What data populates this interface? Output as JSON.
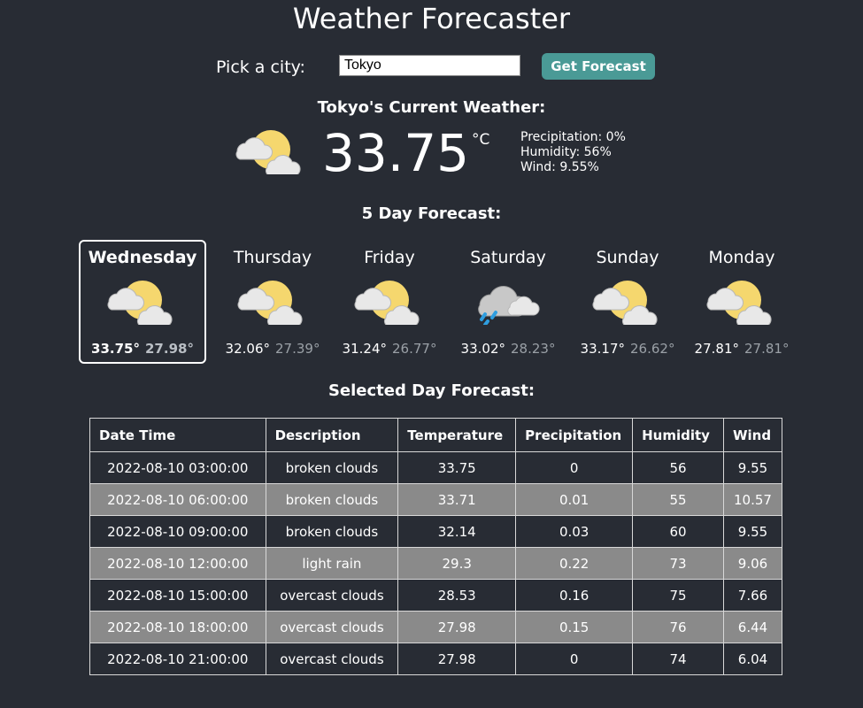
{
  "app": {
    "title": "Weather Forecaster"
  },
  "picker": {
    "label": "Pick a city:",
    "city_value": "Tokyo",
    "button_label": "Get Forecast"
  },
  "current": {
    "heading": "Tokyo's Current Weather:",
    "icon": "partly-cloudy-icon",
    "temperature": "33.75",
    "unit": "°C",
    "precipitation": "Precipitation: 0%",
    "humidity": "Humidity: 56%",
    "wind": "Wind: 9.55%"
  },
  "forecast": {
    "heading": "5 Day Forecast:",
    "days": [
      {
        "name": "Wednesday",
        "icon": "partly-cloudy-icon",
        "high": "33.75°",
        "low": "27.98°",
        "selected": true
      },
      {
        "name": "Thursday",
        "icon": "partly-cloudy-icon",
        "high": "32.06°",
        "low": "27.39°",
        "selected": false
      },
      {
        "name": "Friday",
        "icon": "partly-cloudy-icon",
        "high": "31.24°",
        "low": "26.77°",
        "selected": false
      },
      {
        "name": "Saturday",
        "icon": "rain-cloud-icon",
        "high": "33.02°",
        "low": "28.23°",
        "selected": false
      },
      {
        "name": "Sunday",
        "icon": "partly-cloudy-icon",
        "high": "33.17°",
        "low": "26.62°",
        "selected": false
      },
      {
        "name": "Monday",
        "icon": "partly-cloudy-icon",
        "high": "27.81°",
        "low": "27.81°",
        "selected": false
      }
    ]
  },
  "selected_day": {
    "heading": "Selected Day Forecast:",
    "columns": [
      "Date Time",
      "Description",
      "Temperature",
      "Precipitation",
      "Humidity",
      "Wind"
    ],
    "rows": [
      [
        "2022-08-10 03:00:00",
        "broken clouds",
        "33.75",
        "0",
        "56",
        "9.55"
      ],
      [
        "2022-08-10 06:00:00",
        "broken clouds",
        "33.71",
        "0.01",
        "55",
        "10.57"
      ],
      [
        "2022-08-10 09:00:00",
        "broken clouds",
        "32.14",
        "0.03",
        "60",
        "9.55"
      ],
      [
        "2022-08-10 12:00:00",
        "light rain",
        "29.3",
        "0.22",
        "73",
        "9.06"
      ],
      [
        "2022-08-10 15:00:00",
        "overcast clouds",
        "28.53",
        "0.16",
        "75",
        "7.66"
      ],
      [
        "2022-08-10 18:00:00",
        "overcast clouds",
        "27.98",
        "0.15",
        "76",
        "6.44"
      ],
      [
        "2022-08-10 21:00:00",
        "overcast clouds",
        "27.98",
        "0",
        "74",
        "6.04"
      ]
    ]
  },
  "colors": {
    "background": "#282c34",
    "button": "#4a9a96",
    "sun": "#f5d76e",
    "cloud": "#e8e8e8",
    "rain": "#2f9ee0",
    "alt_row": "#8a8a8a"
  }
}
